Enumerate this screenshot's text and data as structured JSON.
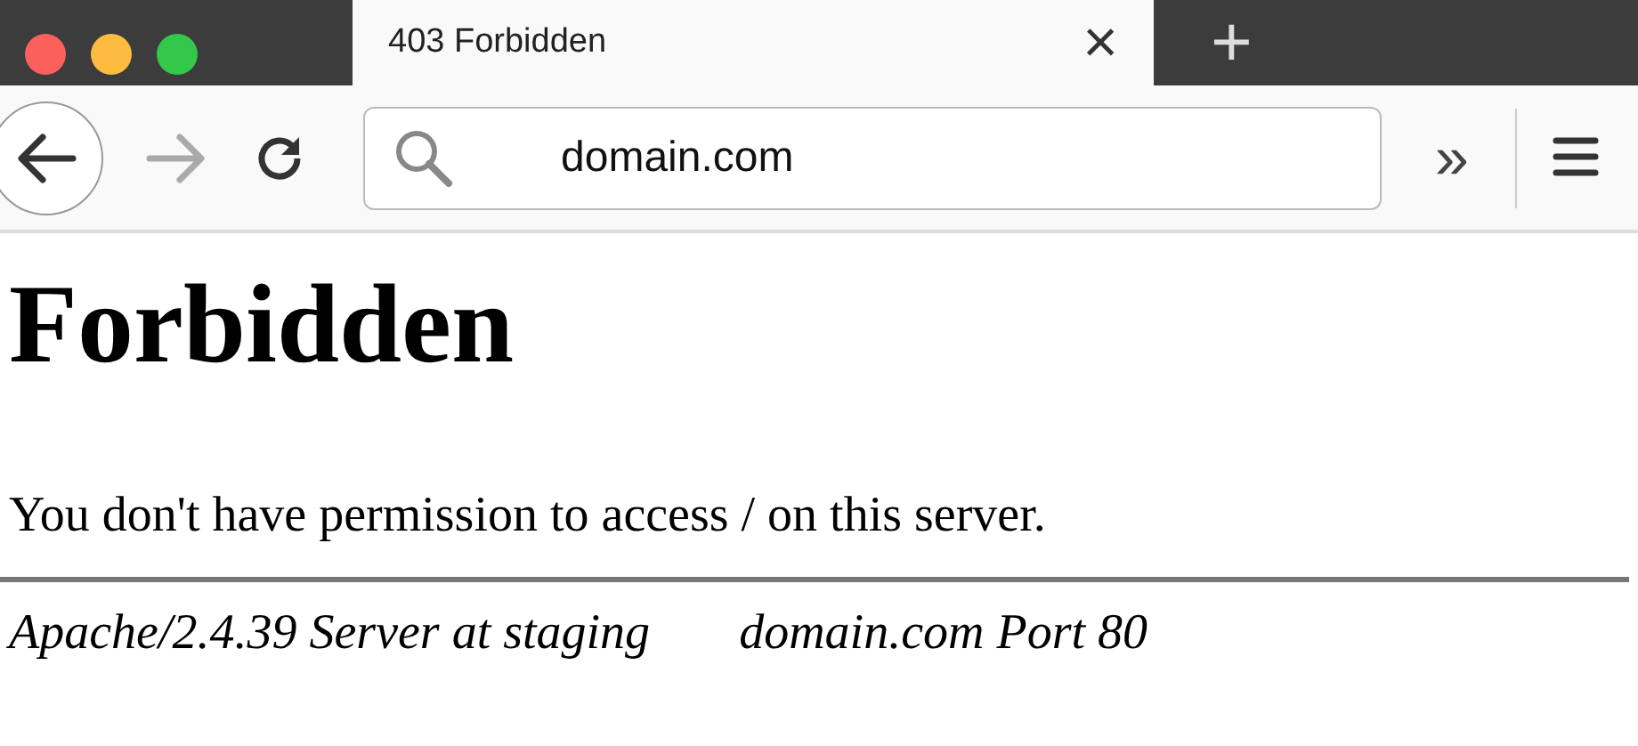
{
  "tab": {
    "title": "403 Forbidden",
    "close": "×",
    "new_tab": "+"
  },
  "toolbar": {
    "back": {
      "disabled": false
    },
    "forward": {
      "disabled": true
    },
    "address": "domain.com",
    "overflow": "»"
  },
  "page": {
    "heading": "Forbidden",
    "message": "You don't have permission to access / on this server.",
    "footer": [
      "Apache/2.4.39 Server at staging",
      "domain.com Port 80"
    ]
  }
}
